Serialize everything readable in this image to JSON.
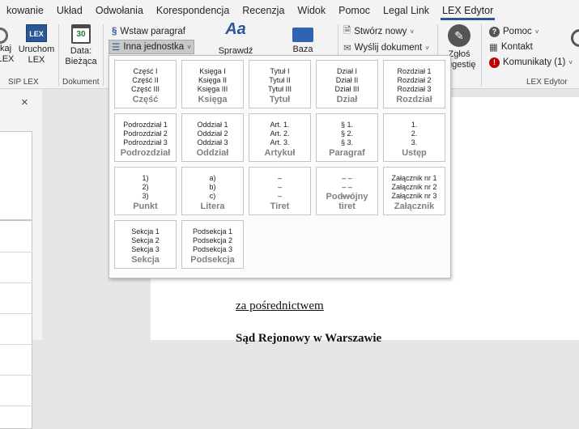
{
  "menu": {
    "tabs": [
      "kowanie",
      "Układ",
      "Odwołania",
      "Korespondencja",
      "Recenzja",
      "Widok",
      "Pomoc",
      "Legal Link",
      "LEX Edytor"
    ],
    "active": "LEX Edytor"
  },
  "ribbon": {
    "sip_lex": {
      "btn1": "kaj\nLEX",
      "btn2": "Uruchom\nLEX",
      "group_label": "SIP LEX"
    },
    "document": {
      "date_btn": "Data:\nBieżąca",
      "group_label": "Dokument",
      "cal_day": "30"
    },
    "insert_paragraph": "Wstaw paragraf",
    "other_unit": "Inna jednostka",
    "check_label": "Sprawdź prawnicze",
    "folder_label": "Baza",
    "create_new": "Stwórz nowy",
    "send_doc": "Wyślij dokument",
    "report": "Zgłoś\nsugestię",
    "help": "Pomoc",
    "contact": "Kontakt",
    "messages": "Komunikaty (1)",
    "lex_editor_label": "LEX Edytor"
  },
  "left_pane": {
    "close": "×"
  },
  "document": {
    "link_text": "za pośrednictwem",
    "next_line": "Sąd Rejonowy w Warszawie"
  },
  "icons": {
    "chevron": "˅",
    "section": "§"
  },
  "tiles": [
    {
      "name": "Część",
      "lines": [
        "Część I",
        "Część II",
        "Część III"
      ]
    },
    {
      "name": "Księga",
      "lines": [
        "Księga I",
        "Księga II",
        "Księga III"
      ]
    },
    {
      "name": "Tytuł",
      "lines": [
        "Tytuł I",
        "Tytuł II",
        "Tytuł III"
      ]
    },
    {
      "name": "Dział",
      "lines": [
        "Dział I",
        "Dział II",
        "Dział III"
      ]
    },
    {
      "name": "Rozdział",
      "lines": [
        "Rozdział 1",
        "Rozdział 2",
        "Rozdział 3"
      ]
    },
    {
      "name": "Podrozdział",
      "lines": [
        "Podrozdział 1",
        "Podrozdział 2",
        "Podrozdział 3"
      ]
    },
    {
      "name": "Oddział",
      "lines": [
        "Oddział 1",
        "Oddział 2",
        "Oddział 3"
      ]
    },
    {
      "name": "Artykuł",
      "lines": [
        "Art. 1.",
        "Art. 2.",
        "Art. 3."
      ]
    },
    {
      "name": "Paragraf",
      "lines": [
        "§ 1.",
        "§ 2.",
        "§ 3."
      ]
    },
    {
      "name": "Ustęp",
      "lines": [
        "1.",
        "2.",
        "3."
      ]
    },
    {
      "name": "Punkt",
      "lines": [
        "1)",
        "2)",
        "3)"
      ]
    },
    {
      "name": "Litera",
      "lines": [
        "a)",
        "b)",
        "c)"
      ]
    },
    {
      "name": "Tiret",
      "lines": [
        "–",
        "–",
        "–"
      ]
    },
    {
      "name": "Podwójny tiret",
      "lines": [
        "– –",
        "– –",
        "– –"
      ]
    },
    {
      "name": "Załącznik",
      "lines": [
        "Załącznik nr 1",
        "Załącznik nr 2",
        "Załącznik nr 3"
      ]
    },
    {
      "name": "Sekcja",
      "lines": [
        "Sekcja 1",
        "Sekcja 2",
        "Sekcja 3"
      ]
    },
    {
      "name": "Podsekcja",
      "lines": [
        "Podsekcja 1",
        "Podsekcja 2",
        "Podsekcja 3"
      ]
    }
  ]
}
